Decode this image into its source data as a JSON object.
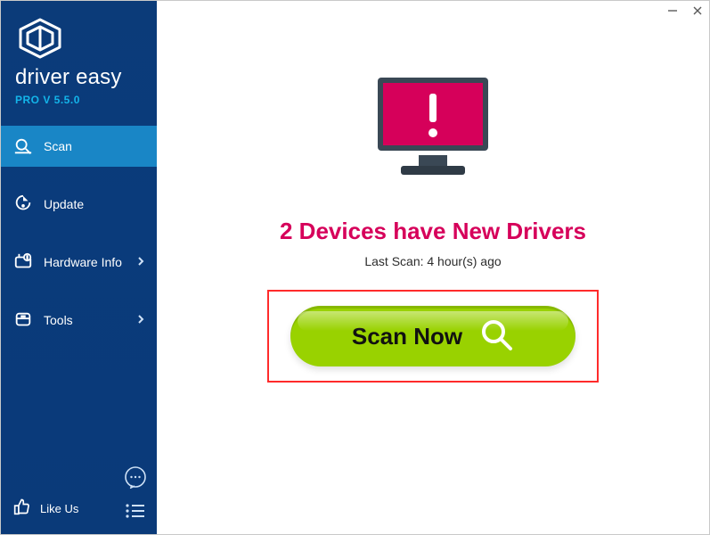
{
  "brand": {
    "name": "driver easy",
    "version_label": "PRO V 5.5.0"
  },
  "sidebar": {
    "items": [
      {
        "label": "Scan"
      },
      {
        "label": "Update"
      },
      {
        "label": "Hardware Info"
      },
      {
        "label": "Tools"
      }
    ],
    "like_label": "Like Us"
  },
  "main": {
    "status_title": "2 Devices have New Drivers",
    "last_scan": "Last Scan: 4 hour(s) ago",
    "scan_button_label": "Scan Now"
  },
  "colors": {
    "accent_pink": "#d6005a",
    "scan_green": "#99d200",
    "sidebar_active": "#1986c6",
    "highlight_red": "#ff2b2b",
    "version_cyan": "#13b5ea"
  }
}
